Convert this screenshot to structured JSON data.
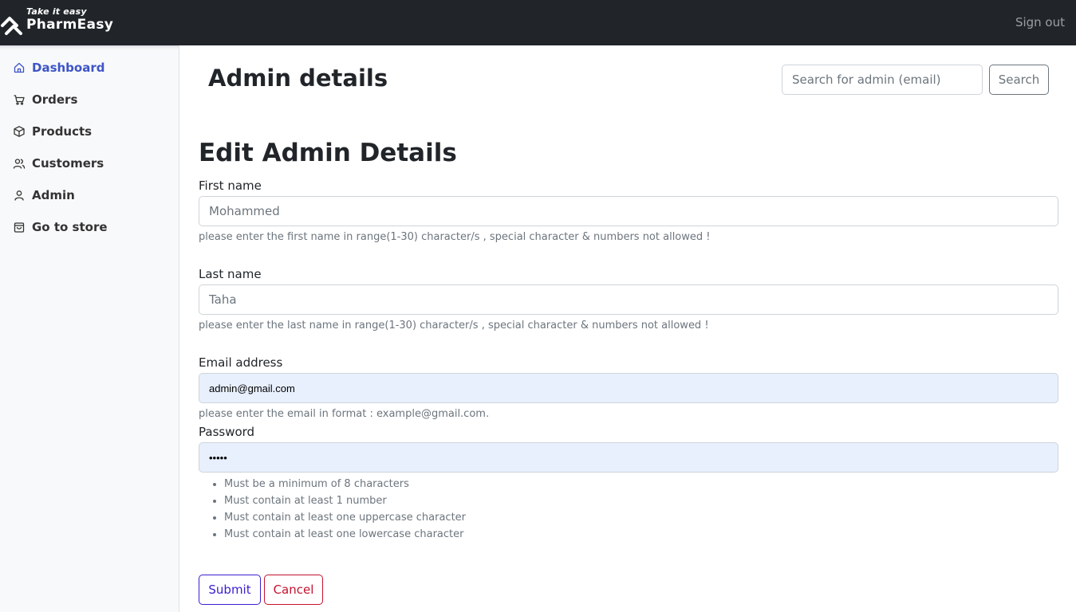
{
  "brand": {
    "tagline": "Take it easy",
    "name": "PharmEasy"
  },
  "topbar": {
    "signout": "Sign out"
  },
  "sidebar": {
    "items": [
      {
        "label": "Dashboard",
        "icon": "home-icon",
        "active": true
      },
      {
        "label": "Orders",
        "icon": "cart-icon"
      },
      {
        "label": "Products",
        "icon": "package-icon"
      },
      {
        "label": "Customers",
        "icon": "users-icon"
      },
      {
        "label": "Admin",
        "icon": "user-icon"
      },
      {
        "label": "Go to store",
        "icon": "shopping-bag-icon"
      }
    ]
  },
  "header": {
    "title": "Admin details",
    "search_placeholder": "Search for admin (email)",
    "search_button": "Search"
  },
  "form": {
    "title": "Edit Admin Details",
    "first_name": {
      "label": "First name",
      "placeholder": "Mohammed",
      "help": "please enter the first name in range(1-30) character/s , special character & numbers not allowed !"
    },
    "last_name": {
      "label": "Last name",
      "placeholder": "Taha",
      "help": "please enter the last name in range(1-30) character/s , special character & numbers not allowed !"
    },
    "email": {
      "label": "Email address",
      "value": "admin@gmail.com",
      "help": "please enter the email in format : example@gmail.com."
    },
    "password": {
      "label": "Password",
      "value": "•••••",
      "rules": [
        "Must be a minimum of 8 characters",
        "Must contain at least 1 number",
        "Must contain at least one uppercase character",
        "Must contain at least one lowercase character"
      ]
    },
    "submit": "Submit",
    "cancel": "Cancel"
  },
  "colors": {
    "topbar": "#212529",
    "sidebar_active": "#3d55c7",
    "submit": "#3a1fd1",
    "cancel": "#c41230",
    "autofill": "#e8f0fe"
  }
}
